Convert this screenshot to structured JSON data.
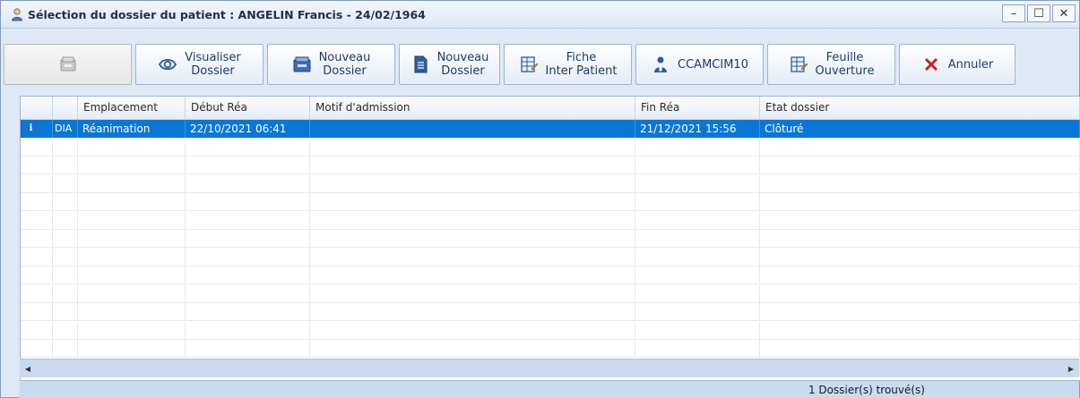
{
  "window": {
    "title": "Sélection du dossier du patient : ANGELIN Francis - 24/02/1964",
    "controls": {
      "minimize": "–",
      "maximize": "☐",
      "close": "✕"
    }
  },
  "toolbar": {
    "buttons": [
      {
        "line1": "",
        "line2": "",
        "icon": "open-folder-icon",
        "enabled": false
      },
      {
        "line1": "Visualiser",
        "line2": "Dossier",
        "icon": "eye-icon",
        "enabled": true
      },
      {
        "line1": "Nouveau",
        "line2": "Dossier",
        "icon": "new-folder-icon",
        "enabled": true
      },
      {
        "line1": "Nouveau",
        "line2": "Dossier",
        "icon": "document-icon",
        "enabled": true
      },
      {
        "line1": "Fiche",
        "line2": "Inter Patient",
        "icon": "sheet-icon",
        "enabled": true
      },
      {
        "line1": "CCAMCIM10",
        "line2": "",
        "icon": "doctor-icon",
        "enabled": true
      },
      {
        "line1": "Feuille",
        "line2": "Ouverture",
        "icon": "sheet-icon",
        "enabled": true
      },
      {
        "line1": "Annuler",
        "line2": "",
        "icon": "cancel-x-icon",
        "enabled": true
      }
    ]
  },
  "grid": {
    "columns": [
      "",
      "",
      "Emplacement",
      "Début Réa",
      "Motif d'admission",
      "Fin Réa",
      "Etat dossier"
    ],
    "rows": [
      {
        "icon": "info-icon",
        "tag": "DIA",
        "emplacement": "Réanimation",
        "debut": "22/10/2021 06:41",
        "motif": "",
        "fin": "21/12/2021 15:56",
        "etat": "Clôturé",
        "selected": true
      }
    ]
  },
  "status": {
    "count_text": "1 Dossier(s) trouvé(s)"
  },
  "colors": {
    "selection": "#0a77d5",
    "accent_red": "#d11a1a",
    "frame": "#dfe9f5"
  }
}
